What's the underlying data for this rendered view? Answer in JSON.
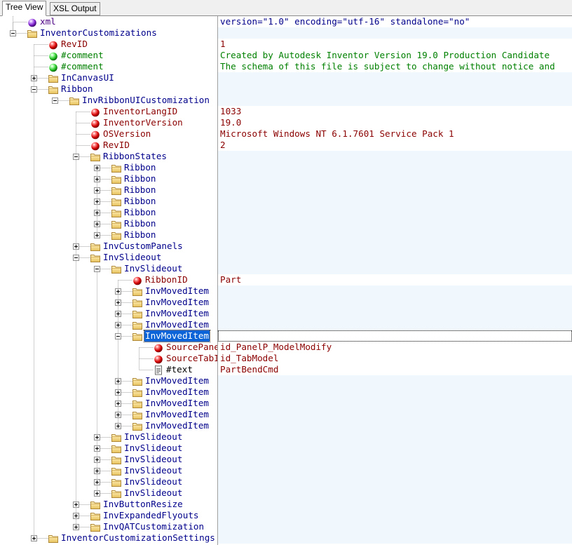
{
  "tabs": [
    "Tree View",
    "XSL Output"
  ],
  "active_tab": 0,
  "colors": {
    "selection": "#0a64d8",
    "value_band": "#f0f8fd",
    "element_text": "#00008b",
    "attribute_text": "#8b0000",
    "comment_text": "#008000"
  },
  "tree": [
    {
      "label": "xml",
      "type": "pi",
      "depth": 0,
      "expander": "none",
      "value": "version=\"1.0\" encoding=\"utf-16\" standalone=\"no\""
    },
    {
      "label": "InventorCustomizations",
      "type": "element",
      "depth": 0,
      "expander": "minus",
      "value": ""
    },
    {
      "label": "RevID",
      "type": "attribute",
      "depth": 1,
      "expander": "none",
      "value": "1"
    },
    {
      "label": "#comment",
      "type": "comment",
      "depth": 1,
      "expander": "none",
      "value": "Created by Autodesk Inventor Version 19.0 Production Candidate"
    },
    {
      "label": "#comment",
      "type": "comment",
      "depth": 1,
      "expander": "none",
      "value": "The schema of this file is subject to change without notice and"
    },
    {
      "label": "InCanvasUI",
      "type": "element",
      "depth": 1,
      "expander": "plus",
      "value": ""
    },
    {
      "label": "Ribbon",
      "type": "element",
      "depth": 1,
      "expander": "minus",
      "value": ""
    },
    {
      "label": "InvRibbonUICustomization",
      "type": "element",
      "depth": 2,
      "expander": "minus",
      "value": ""
    },
    {
      "label": "InventorLangID",
      "type": "attribute",
      "depth": 3,
      "expander": "none",
      "value": "1033"
    },
    {
      "label": "InventorVersion",
      "type": "attribute",
      "depth": 3,
      "expander": "none",
      "value": "19.0"
    },
    {
      "label": "OSVersion",
      "type": "attribute",
      "depth": 3,
      "expander": "none",
      "value": "Microsoft Windows NT 6.1.7601 Service Pack 1"
    },
    {
      "label": "RevID",
      "type": "attribute",
      "depth": 3,
      "expander": "none",
      "value": "2"
    },
    {
      "label": "RibbonStates",
      "type": "element",
      "depth": 3,
      "expander": "minus",
      "value": ""
    },
    {
      "label": "Ribbon",
      "type": "element",
      "depth": 4,
      "expander": "plus",
      "value": ""
    },
    {
      "label": "Ribbon",
      "type": "element",
      "depth": 4,
      "expander": "plus",
      "value": ""
    },
    {
      "label": "Ribbon",
      "type": "element",
      "depth": 4,
      "expander": "plus",
      "value": ""
    },
    {
      "label": "Ribbon",
      "type": "element",
      "depth": 4,
      "expander": "plus",
      "value": ""
    },
    {
      "label": "Ribbon",
      "type": "element",
      "depth": 4,
      "expander": "plus",
      "value": ""
    },
    {
      "label": "Ribbon",
      "type": "element",
      "depth": 4,
      "expander": "plus",
      "value": ""
    },
    {
      "label": "Ribbon",
      "type": "element",
      "depth": 4,
      "expander": "plus",
      "value": ""
    },
    {
      "label": "InvCustomPanels",
      "type": "element",
      "depth": 3,
      "expander": "plus",
      "value": ""
    },
    {
      "label": "InvSlideout",
      "type": "element",
      "depth": 3,
      "expander": "minus",
      "value": ""
    },
    {
      "label": "InvSlideout",
      "type": "element",
      "depth": 4,
      "expander": "minus",
      "value": ""
    },
    {
      "label": "RibbonID",
      "type": "attribute",
      "depth": 5,
      "expander": "none",
      "value": "Part"
    },
    {
      "label": "InvMovedItem",
      "type": "element",
      "depth": 5,
      "expander": "plus",
      "value": ""
    },
    {
      "label": "InvMovedItem",
      "type": "element",
      "depth": 5,
      "expander": "plus",
      "value": ""
    },
    {
      "label": "InvMovedItem",
      "type": "element",
      "depth": 5,
      "expander": "plus",
      "value": ""
    },
    {
      "label": "InvMovedItem",
      "type": "element",
      "depth": 5,
      "expander": "plus",
      "value": ""
    },
    {
      "label": "InvMovedItem",
      "type": "element",
      "depth": 5,
      "expander": "minus",
      "value": "",
      "selected": true
    },
    {
      "label": "SourcePanelI",
      "type": "attribute",
      "depth": 6,
      "expander": "none",
      "value": "id_PanelP_ModelModify"
    },
    {
      "label": "SourceTabID",
      "type": "attribute",
      "depth": 6,
      "expander": "none",
      "value": "id_TabModel"
    },
    {
      "label": "#text",
      "type": "text",
      "depth": 6,
      "expander": "none",
      "value": "PartBendCmd"
    },
    {
      "label": "InvMovedItem",
      "type": "element",
      "depth": 5,
      "expander": "plus",
      "value": ""
    },
    {
      "label": "InvMovedItem",
      "type": "element",
      "depth": 5,
      "expander": "plus",
      "value": ""
    },
    {
      "label": "InvMovedItem",
      "type": "element",
      "depth": 5,
      "expander": "plus",
      "value": ""
    },
    {
      "label": "InvMovedItem",
      "type": "element",
      "depth": 5,
      "expander": "plus",
      "value": ""
    },
    {
      "label": "InvMovedItem",
      "type": "element",
      "depth": 5,
      "expander": "plus",
      "value": ""
    },
    {
      "label": "InvSlideout",
      "type": "element",
      "depth": 4,
      "expander": "plus",
      "value": ""
    },
    {
      "label": "InvSlideout",
      "type": "element",
      "depth": 4,
      "expander": "plus",
      "value": ""
    },
    {
      "label": "InvSlideout",
      "type": "element",
      "depth": 4,
      "expander": "plus",
      "value": ""
    },
    {
      "label": "InvSlideout",
      "type": "element",
      "depth": 4,
      "expander": "plus",
      "value": ""
    },
    {
      "label": "InvSlideout",
      "type": "element",
      "depth": 4,
      "expander": "plus",
      "value": ""
    },
    {
      "label": "InvSlideout",
      "type": "element",
      "depth": 4,
      "expander": "plus",
      "value": ""
    },
    {
      "label": "InvButtonResize",
      "type": "element",
      "depth": 3,
      "expander": "plus",
      "value": ""
    },
    {
      "label": "InvExpandedFlyouts",
      "type": "element",
      "depth": 3,
      "expander": "plus",
      "value": ""
    },
    {
      "label": "InvQATCustomization",
      "type": "element",
      "depth": 3,
      "expander": "plus",
      "value": ""
    },
    {
      "label": "InventorCustomizationSettings",
      "type": "element",
      "depth": 1,
      "expander": "plus",
      "value": ""
    }
  ]
}
